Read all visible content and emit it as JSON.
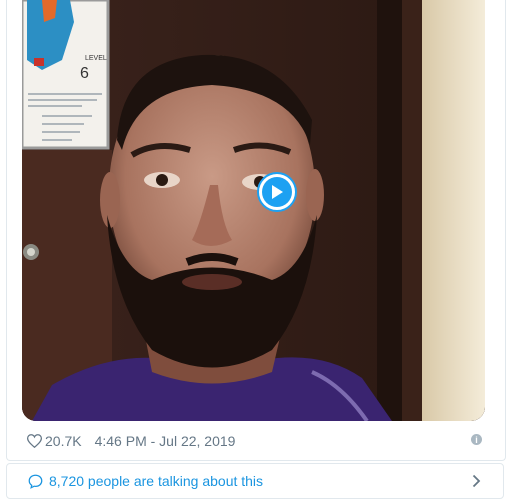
{
  "tweet": {
    "likes": "20.7K",
    "timestamp": "4:46 PM - Jul 22, 2019"
  },
  "sign": {
    "level_label": "LEVEL",
    "level_number": "6"
  },
  "conversation": {
    "text": "8,720 people are talking about this"
  },
  "icons": {
    "like": "heart-outline-icon",
    "info": "info-icon",
    "play": "play-icon",
    "conversation": "speech-bubble-icon",
    "chevron": "chevron-right-icon"
  },
  "colors": {
    "accent": "#1da1f2",
    "link": "#1b95e0",
    "muted": "#657786"
  }
}
